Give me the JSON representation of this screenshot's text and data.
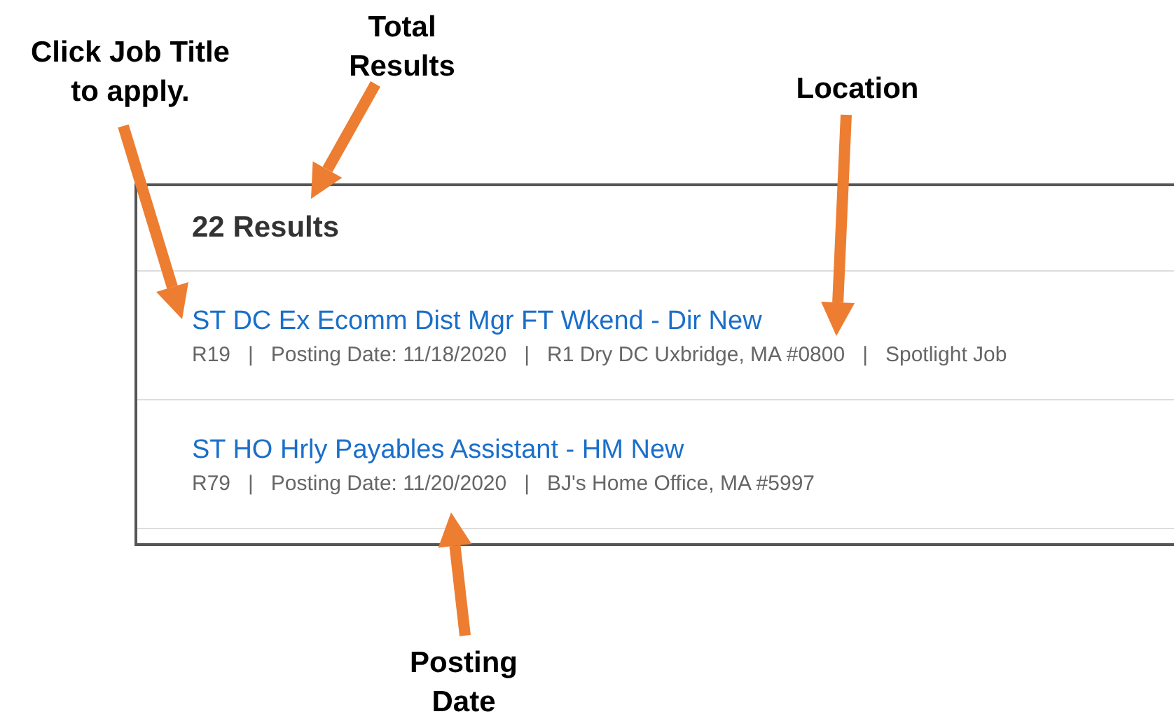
{
  "results_panel": {
    "count": "22 Results",
    "jobs": [
      {
        "title": "ST DC Ex Ecomm Dist Mgr FT Wkend - Dir New",
        "meta": "R19   |   Posting Date: 11/18/2020   |   R1 Dry DC Uxbridge, MA #0800   |   Spotlight Job"
      },
      {
        "title": "ST HO Hrly Payables Assistant - HM New",
        "meta": "R79   |   Posting Date: 11/20/2020   |   BJ's Home Office, MA #5997"
      }
    ]
  },
  "annotations": [
    {
      "lines": [
        "Click Job Title",
        "to apply."
      ],
      "kind": "job_title"
    },
    {
      "lines": [
        "Total",
        "Results"
      ],
      "kind": "count"
    },
    {
      "lines": [
        "Location"
      ],
      "kind": "location"
    },
    {
      "lines": [
        "Posting",
        "Date"
      ],
      "kind": "posting_date"
    }
  ]
}
